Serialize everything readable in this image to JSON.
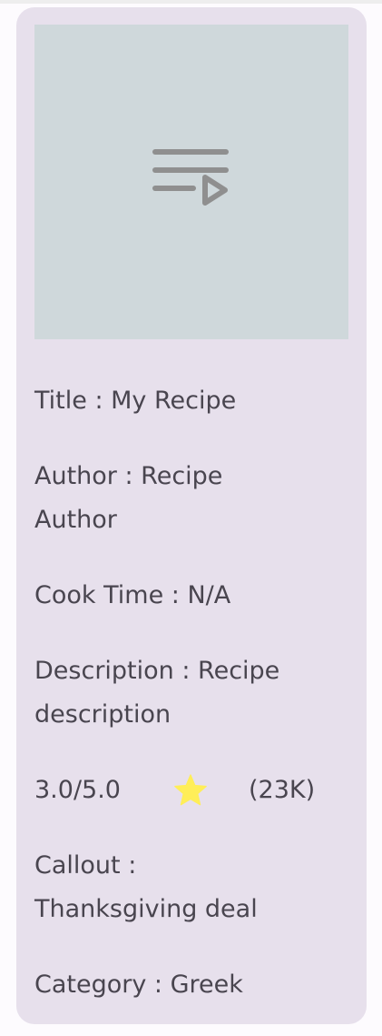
{
  "recipe": {
    "image_icon": "playlist-play-icon",
    "title": "Title : My Recipe",
    "author": "Author : Recipe Author",
    "cook_time": "Cook Time : N/A",
    "description": "Description : Recipe description",
    "rating_value": "3.0/5.0",
    "rating_icon": "star-icon",
    "rating_count": "(23K)",
    "callout": "Callout : Thanksgiving deal",
    "category": "Category : Greek"
  },
  "colors": {
    "card_background": "#e7e0ec",
    "image_placeholder": "#cfd8db",
    "text": "#49454f",
    "star": "#ffee58",
    "icon": "#8f8f8f"
  }
}
